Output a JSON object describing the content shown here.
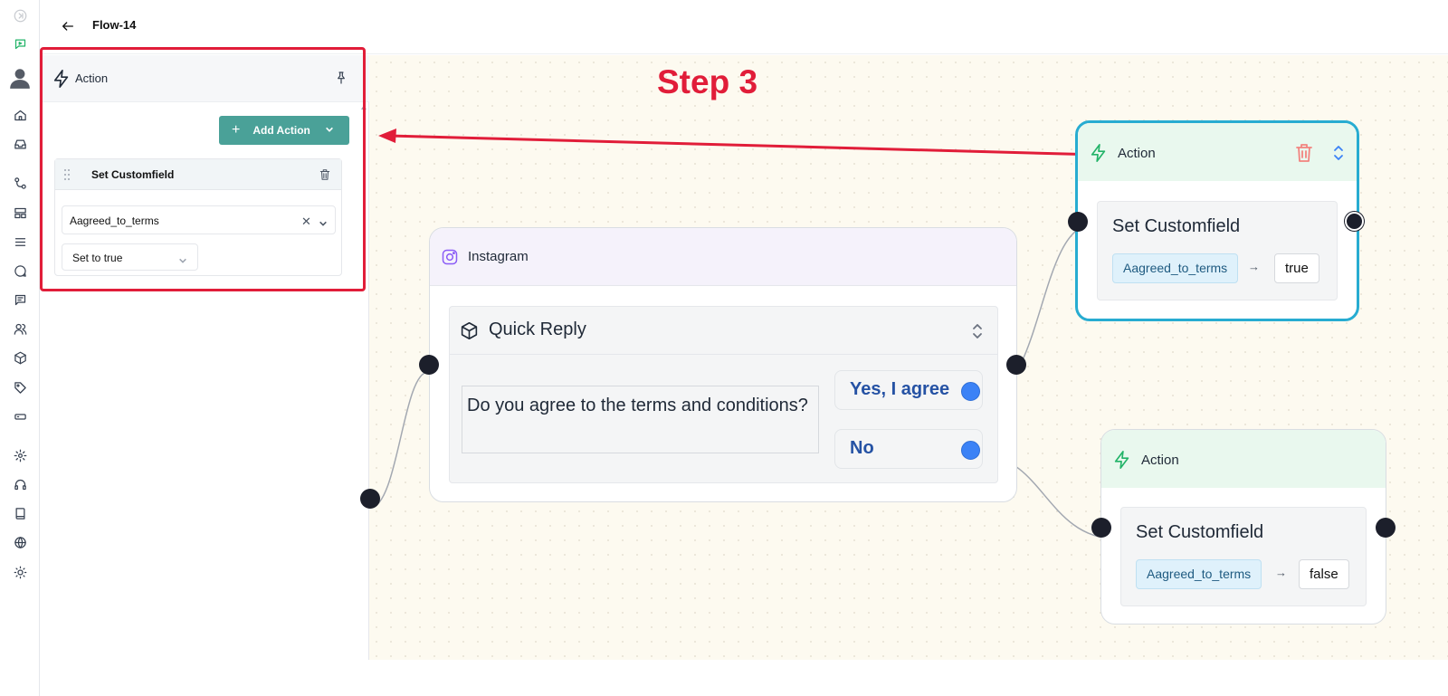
{
  "header": {
    "title": "Flow-14"
  },
  "sidebar": {
    "icons": [
      "collapse-icon",
      "chatbot-icon",
      "user-avatar-icon",
      "home-icon",
      "inbox-icon",
      "flows-icon",
      "templates-icon",
      "list-icon",
      "chat-icon",
      "messages-icon",
      "contacts-icon",
      "products-icon",
      "tags-icon",
      "tickets-icon",
      "settings-icon",
      "support-icon",
      "docs-icon",
      "globe-icon",
      "theme-icon"
    ]
  },
  "panel": {
    "title": "Action",
    "add_action_label": "Add Action",
    "card": {
      "title": "Set Customfield",
      "field_value": "Aagreed_to_terms",
      "value_option": "Set to true"
    }
  },
  "annotation": {
    "step_label": "Step 3",
    "color": "#e11d39"
  },
  "instagram_node": {
    "title": "Instagram",
    "quick_reply_title": "Quick Reply",
    "question": "Do you agree to the terms and conditions?",
    "buttons": [
      "Yes, I agree",
      "No"
    ]
  },
  "action_node_top": {
    "title": "Action",
    "body_title": "Set Customfield",
    "field": "Aagreed_to_terms",
    "value": "true",
    "selected": true
  },
  "action_node_bottom": {
    "title": "Action",
    "body_title": "Set Customfield",
    "field": "Aagreed_to_terms",
    "value": "false"
  },
  "colors": {
    "accent": "#4aa198",
    "selected_border": "#27acd1",
    "port": "#1c1f2b",
    "reply_port": "#3b82f6"
  }
}
